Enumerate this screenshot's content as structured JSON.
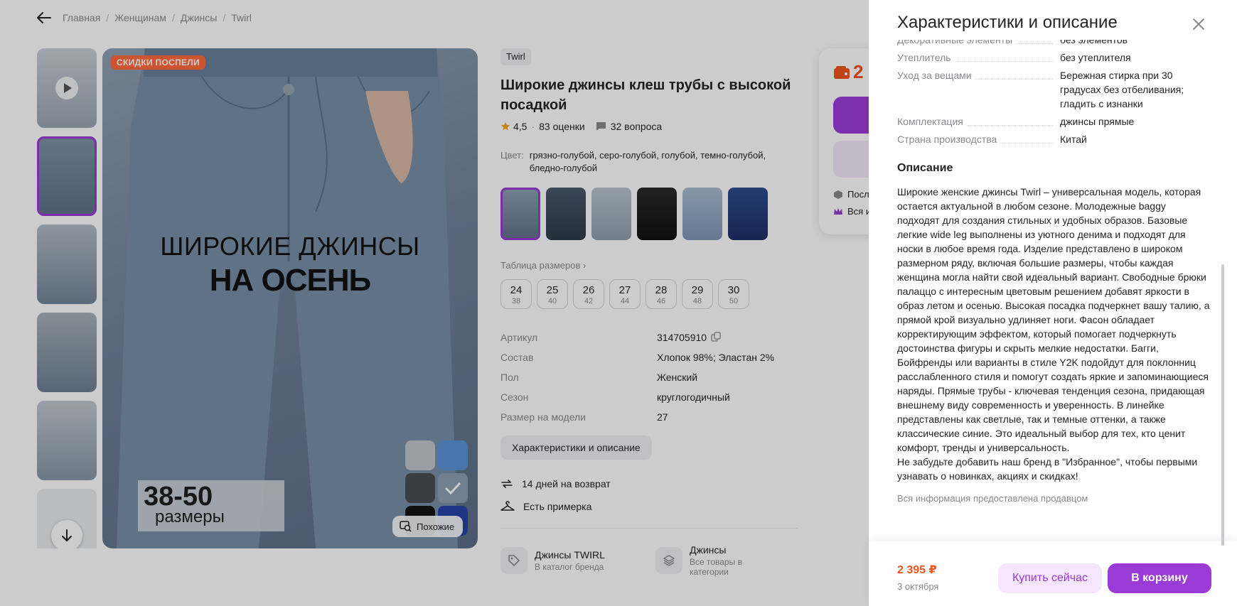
{
  "breadcrumbs": [
    "Главная",
    "Женщинам",
    "Джинсы",
    "Twirl"
  ],
  "gallery": {
    "promo_badge": "СКИДКИ ПОСПЕЛИ",
    "photo_title_line1": "ШИРОКИЕ ДЖИНСЫ",
    "photo_title_line2": "НА ОСЕНЬ",
    "size_range": "38-50",
    "size_word": "размеры",
    "similar_label": "Похожие"
  },
  "product": {
    "brand": "Twirl",
    "title": "Широкие джинсы клеш трубы с высокой посадкой",
    "rating": "4,5",
    "ratings_count": "83 оценки",
    "questions_count": "32 вопроса",
    "color_label": "Цвет:",
    "color_values": "грязно-голубой, серо-голубой, голубой, темно-голубой, бледно-голубой",
    "size_table_label": "Таблица размеров",
    "sizes": [
      {
        "size": "24",
        "ru": "38"
      },
      {
        "size": "25",
        "ru": "40"
      },
      {
        "size": "26",
        "ru": "42"
      },
      {
        "size": "27",
        "ru": "44"
      },
      {
        "size": "28",
        "ru": "46"
      },
      {
        "size": "29",
        "ru": "48"
      },
      {
        "size": "30",
        "ru": "50"
      }
    ],
    "specs": [
      {
        "key": "Артикул",
        "value": "314705910"
      },
      {
        "key": "Состав",
        "value": "Хлопок 98%; Эластан 2%"
      },
      {
        "key": "Пол",
        "value": "Женский"
      },
      {
        "key": "Сезон",
        "value": "круглогодичный"
      },
      {
        "key": "Размер на модели",
        "value": "27"
      }
    ],
    "char_button": "Характеристики и описание",
    "perks": [
      "14 дней на возврат",
      "Есть примерка"
    ],
    "links": [
      {
        "title": "Джинсы TWIRL",
        "sub": "В каталог бренда"
      },
      {
        "title": "Джинсы",
        "sub": "Все товары в категории"
      }
    ]
  },
  "buybox": {
    "price_partial": "2",
    "line1_partial": "Посл",
    "line2_partial": "Вся и"
  },
  "drawer": {
    "title": "Характеристики и описание",
    "rows": [
      {
        "key": "Декоративные элементы",
        "value": "без элементов"
      },
      {
        "key": "Утеплитель",
        "value": "без утеплителя"
      },
      {
        "key": "Уход за вещами",
        "value": "Бережная стирка при 30 градусах без отбеливания; гладить с изнанки"
      },
      {
        "key": "Комплектация",
        "value": "джинсы прямые"
      },
      {
        "key": "Страна производства",
        "value": "Китай"
      }
    ],
    "description_heading": "Описание",
    "description": "Широкие женские джинсы Twirl – универсальная модель, которая остается актуальной в любом сезоне. Молодежные baggy подходят для создания стильных и удобных образов. Базовые легкие wide leg выполнены из уютного денима и подходят для носки в любое время года. Изделие представлено в широком размерном ряду, включая большие размеры, чтобы каждая женщина могла найти свой идеальный вариант. Свободные брюки палаццо с интересным цветовым решением добавят яркости в образ летом и осенью. Высокая посадка подчеркнет вашу талию, а прямой крой визуально удлиняет ноги. Фасон обладает корректирующим эффектом, который помогает подчеркнуть достоинства фигуры и скрыть мелкие недостатки. Багги, Бойфренды или варианты в стиле Y2K подойдут для поклонниц расслабленного стиля и помогут создать яркие и запоминающиеся наряды. Прямые трубы - ключевая тенденция сезона, придающая внешнему виду современность и уверенность. В линейке представлены как светлые, так и темные оттенки, а также классические синие. Это идеальный выбор для тех, кто ценит комфорт, тренды и универсальность.\nНе забудьте добавить наш бренд в \"Избранное\", чтобы первыми узнавать о новинках, акциях и скидках!",
    "seller_note": "Вся информация предоставлена продавцом",
    "footer": {
      "price": "2 395 ₽",
      "date": "3 октября",
      "buy_now": "Купить сейчас",
      "add_to_cart": "В корзину"
    }
  },
  "colors": {
    "accent": "#9b3bd6",
    "price": "#f0541e",
    "promo": "#ff6a3d"
  }
}
